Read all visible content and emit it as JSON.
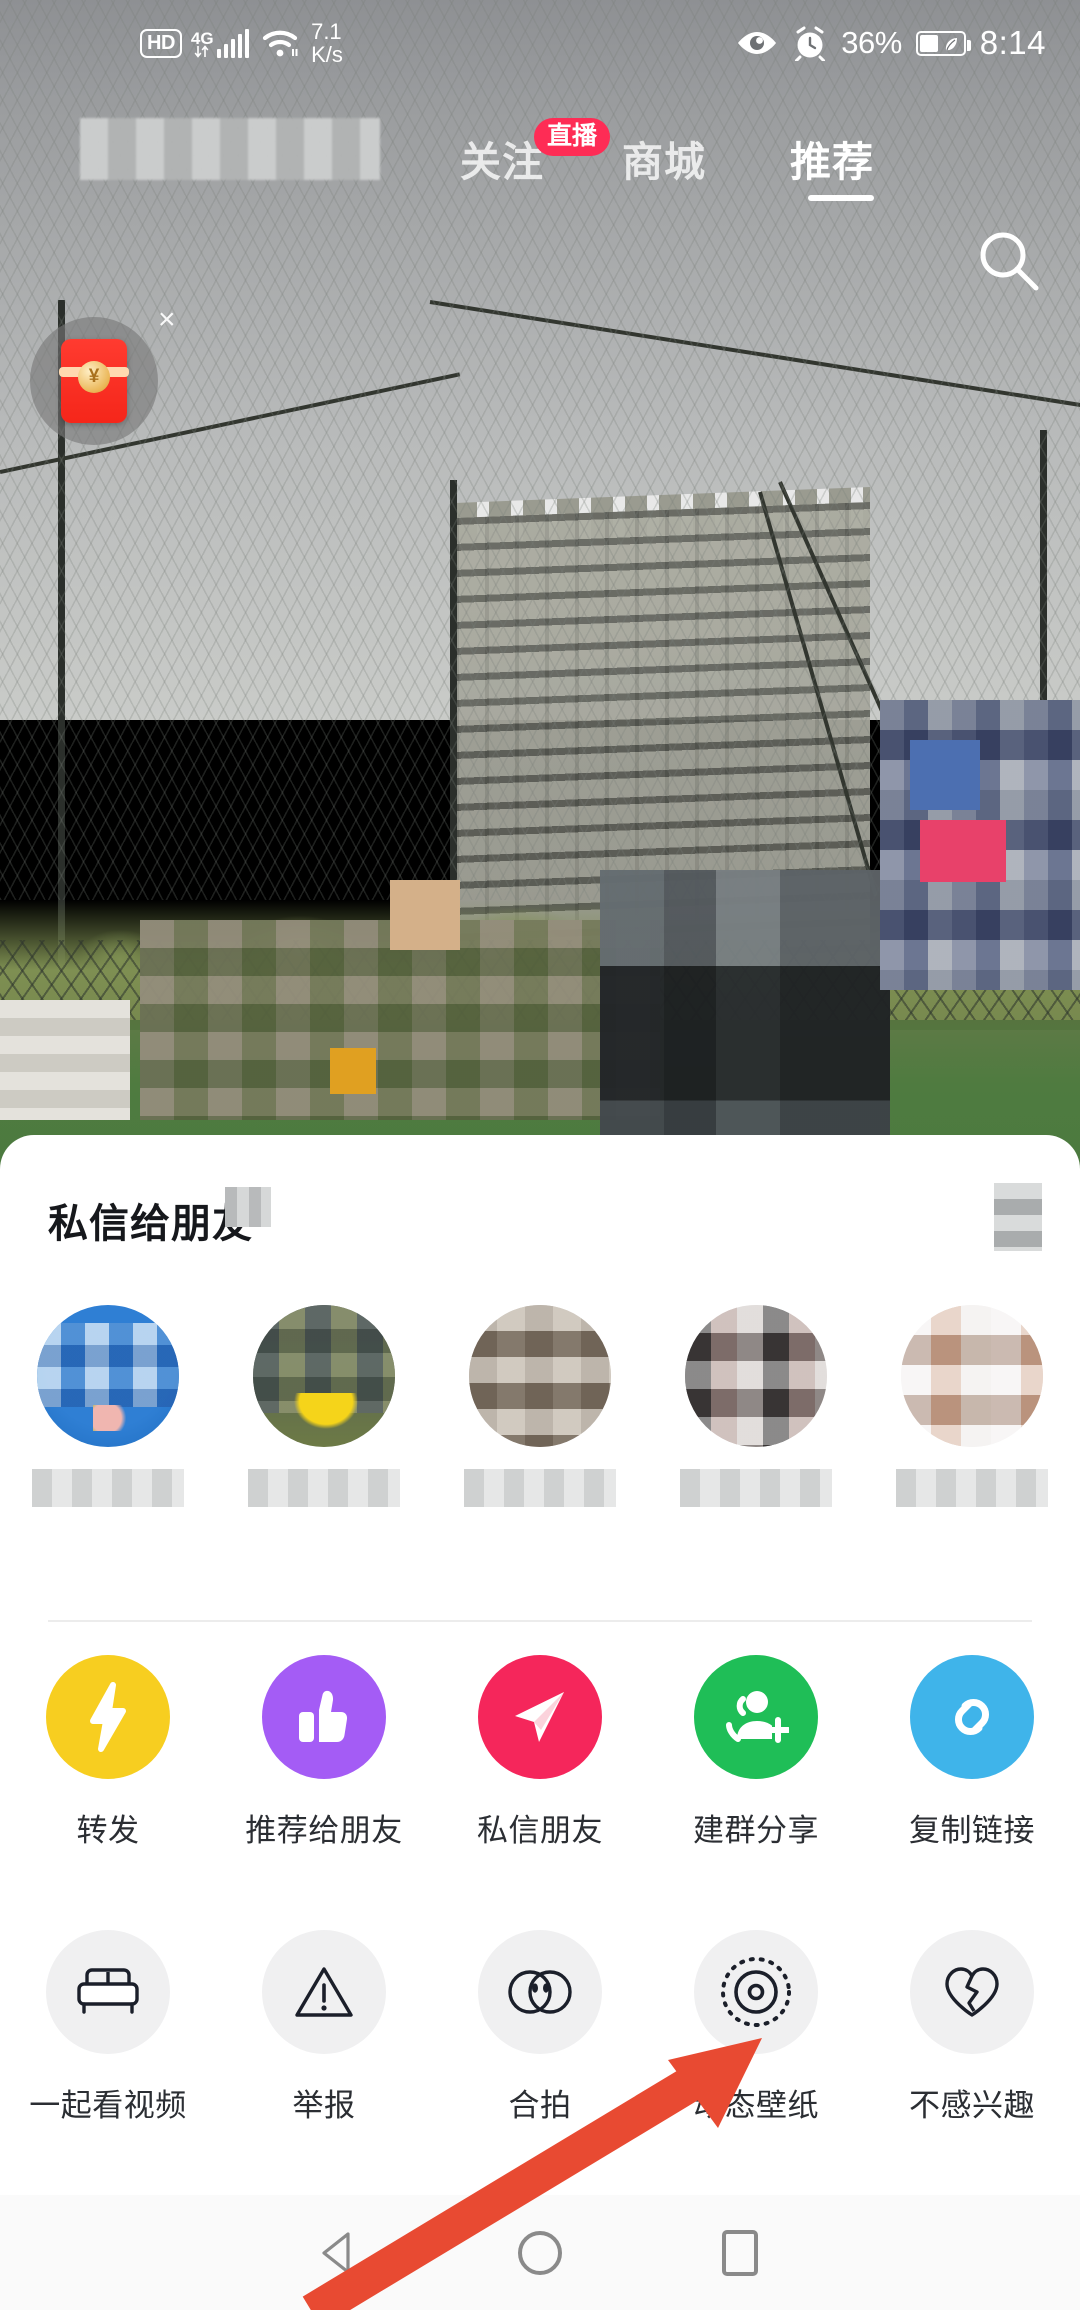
{
  "status_bar": {
    "hd_label": "HD",
    "network_type": "4G",
    "speed_value": "7.1",
    "speed_unit": "K/s",
    "battery_percent": "36%",
    "time": "8:14",
    "icons": {
      "eye": "eye-care-icon",
      "alarm": "alarm-clock-icon",
      "battery": "battery-saver-icon",
      "wifi": "wifi-icon",
      "signal": "signal-bars-icon"
    }
  },
  "top_nav": {
    "tabs": [
      {
        "label": "关注",
        "active": false,
        "badge": "直播"
      },
      {
        "label": "商城",
        "active": false,
        "badge": ""
      },
      {
        "label": "推荐",
        "active": true,
        "badge": ""
      }
    ],
    "search_icon": "search-icon"
  },
  "float": {
    "redpacket_icon": "red-packet-icon",
    "redpacket_currency": "¥",
    "close_label": "×"
  },
  "share_sheet": {
    "title": "私信给朋友",
    "friends": [
      {
        "name": "",
        "avatar": "av1"
      },
      {
        "name": "",
        "avatar": "av2"
      },
      {
        "name": "",
        "avatar": "av3"
      },
      {
        "name": "",
        "avatar": "av4"
      },
      {
        "name": "",
        "avatar": "av5"
      }
    ],
    "actions_row1": [
      {
        "label": "转发",
        "icon": "lightning-bolt-icon",
        "color": "#F7CE20"
      },
      {
        "label": "推荐给朋友",
        "icon": "thumbs-up-icon",
        "color": "#A45CF5"
      },
      {
        "label": "私信朋友",
        "icon": "paper-plane-icon",
        "color": "#F5265B"
      },
      {
        "label": "建群分享",
        "icon": "add-group-icon",
        "color": "#1FBE57"
      },
      {
        "label": "复制链接",
        "icon": "link-chain-icon",
        "color": "#3FB4EA"
      }
    ],
    "actions_row2": [
      {
        "label": "一起看视频",
        "icon": "sofa-icon",
        "color": "#F0F0F1"
      },
      {
        "label": "举报",
        "icon": "warning-triangle-icon",
        "color": "#F0F0F1"
      },
      {
        "label": "合拍",
        "icon": "duet-faces-icon",
        "color": "#F0F0F1"
      },
      {
        "label": "动态壁纸",
        "icon": "live-wallpaper-icon",
        "color": "#F0F0F1"
      },
      {
        "label": "不感兴趣",
        "icon": "broken-heart-icon",
        "color": "#F0F0F1"
      }
    ]
  },
  "nav_bar": {
    "back": "back-triangle-icon",
    "home": "home-circle-icon",
    "recents": "recents-square-icon"
  },
  "annotation": {
    "arrow_color": "#E84A32",
    "points_at": "动态壁纸"
  }
}
